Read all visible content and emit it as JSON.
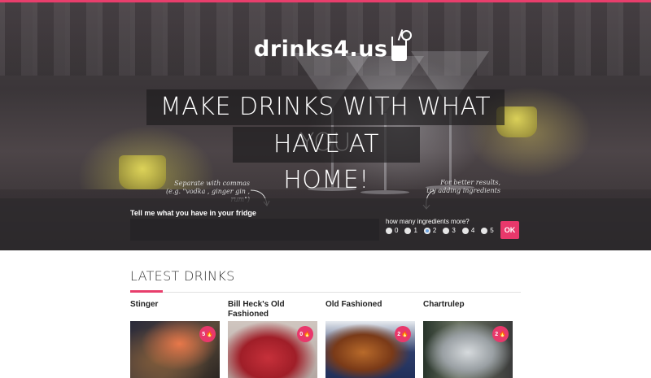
{
  "brand": {
    "logo_text": "drinks4.us",
    "accent_color": "#e83e6c"
  },
  "hero": {
    "headline_line1": "MAKE DRINKS WITH WHAT YOU",
    "headline_line2": "HAVE AT HOME!",
    "hint_left_line1": "Separate with commas",
    "hint_left_line2": "(e.g. \"vodka , ginger gin , rum\")",
    "hint_right_line1": "For better results,",
    "hint_right_line2": "try adding ingredients"
  },
  "search_form": {
    "fridge_label": "Tell me what you have in your fridge",
    "fridge_value": "",
    "more_label": "how many ingredients more?",
    "options": [
      "0",
      "1",
      "2",
      "3",
      "4",
      "5"
    ],
    "selected_option": "2",
    "submit_label": "OK"
  },
  "latest": {
    "title": "LATEST DRINKS",
    "drinks": [
      {
        "name": "Stinger",
        "count": "5",
        "icon": "flame-icon"
      },
      {
        "name": "Bill Heck's Old Fashioned",
        "count": "0",
        "icon": "flame-icon"
      },
      {
        "name": "Old Fashioned",
        "count": "2",
        "icon": "flame-icon"
      },
      {
        "name": "Chartrulep",
        "count": "2",
        "icon": "flame-icon"
      }
    ]
  }
}
